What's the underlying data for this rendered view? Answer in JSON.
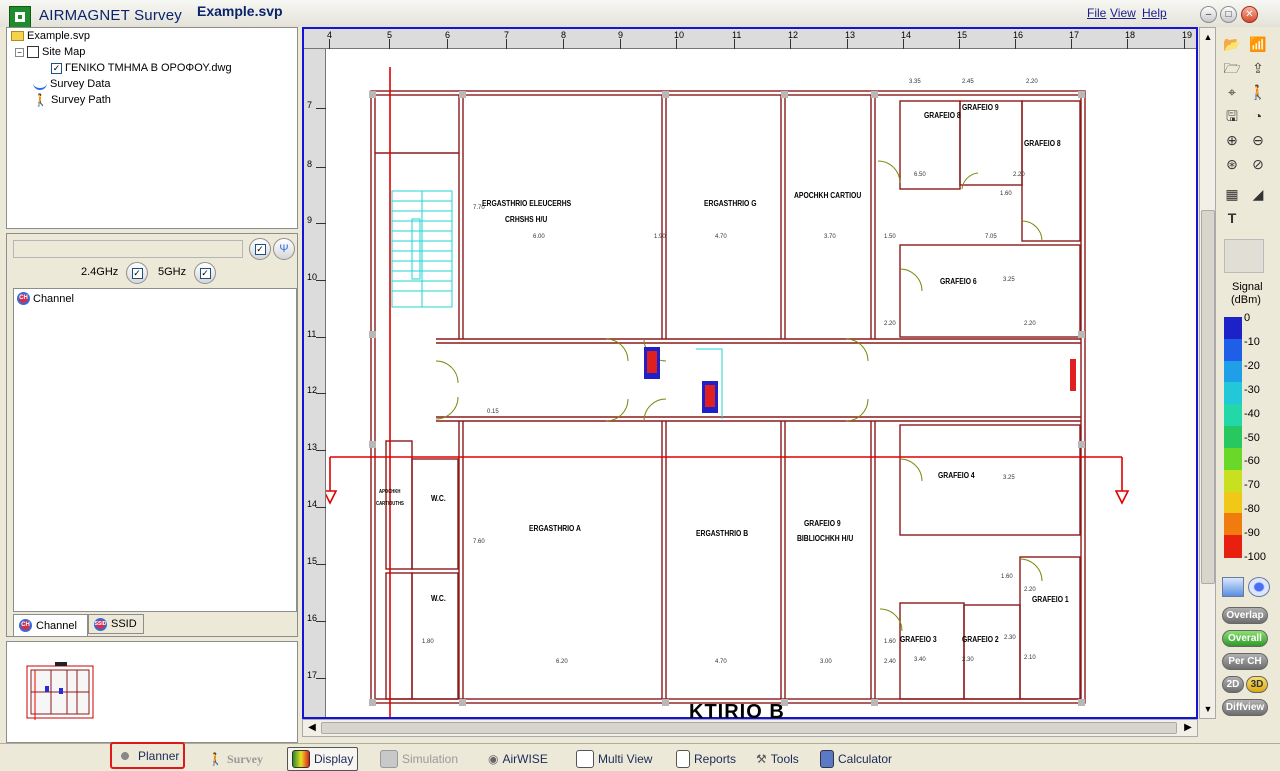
{
  "app": {
    "title": "AIRMAGNET Survey",
    "file": "Example.svp"
  },
  "menu": [
    "File",
    "View",
    "Help"
  ],
  "tree": {
    "root": "Example.svp",
    "site_map": "Site Map",
    "dwg": "ΓΕΝΙΚΟ ΤΜΗΜΑ  Β ΟΡΟΦΟΥ.dwg",
    "survey_data": "Survey Data",
    "survey_path": "Survey Path"
  },
  "bands": {
    "b24": "2.4GHz",
    "b5": "5GHz"
  },
  "channel_list": {
    "item": "Channel"
  },
  "tabs": {
    "channel": "Channel",
    "ssid": "SSID"
  },
  "rulers": {
    "h": [
      "4",
      "5",
      "6",
      "7",
      "8",
      "9",
      "10",
      "11",
      "12",
      "13",
      "14",
      "15",
      "16",
      "17",
      "18",
      "19"
    ],
    "v": [
      "7",
      "8",
      "9",
      "10",
      "11",
      "12",
      "13",
      "14",
      "15",
      "16",
      "17"
    ]
  },
  "floorplan": {
    "rooms": [
      "ERGASTHRIO ELEUCERHS",
      "CRHSHS H/U",
      "ERGASTHRIO G",
      "APOCHKH CARTIOU",
      "GRAFEIO 8",
      "GRAFEIO 9",
      "GRAFEIO 8",
      "GRAFEIO 6",
      "GRAFEIO 4",
      "ERGASTHRIO A",
      "ERGASTHRIO B",
      "GRAFEIO 9",
      "BIBLIOCHKH H/U",
      "W.C.",
      "W.C.",
      "GRAFEIO 3",
      "GRAFEIO 2",
      "GRAFEIO 1",
      "APOCHKH",
      "CARTIOUTHS"
    ],
    "dims": [
      "6.00",
      "4.70",
      "3.70",
      "1.50",
      "7.05",
      "3.35",
      "2.45",
      "2.20",
      "6.50",
      "2.20",
      "2.20",
      "1.60",
      "3.25",
      "3.25",
      "2.20",
      "2.20",
      "1.60",
      "6.20",
      "4.70",
      "3.00",
      "3.40",
      "2.30",
      "2.10",
      "1.90",
      "1.60",
      "7.70",
      "7.60",
      "2.40",
      "2.30",
      "1.80",
      "0.15"
    ],
    "building_label": "KTIRIO B"
  },
  "legend": {
    "title": "Signal",
    "unit": "(dBm)",
    "ticks": [
      "0",
      "-10",
      "-20",
      "-30",
      "-40",
      "-50",
      "-60",
      "-70",
      "-80",
      "-90",
      "-100"
    ],
    "colors": [
      "#1c22c8",
      "#1f5ee6",
      "#1f9fe8",
      "#22c8d8",
      "#22d8a8",
      "#28c860",
      "#6ad828",
      "#c8e020",
      "#f0c818",
      "#f07c10",
      "#e82010"
    ]
  },
  "mode_buttons": {
    "overlap": "Overlap",
    "overall": "Overall",
    "perch": "Per CH",
    "d2": "2D",
    "d3": "3D",
    "diffview": "Diffview"
  },
  "bottom": {
    "planner": "Planner",
    "survey": "Survey",
    "display": "Display",
    "simulation": "Simulation",
    "airwise": "AirWISE",
    "multiview": "Multi View",
    "reports": "Reports",
    "tools": "Tools",
    "calculator": "Calculator"
  }
}
